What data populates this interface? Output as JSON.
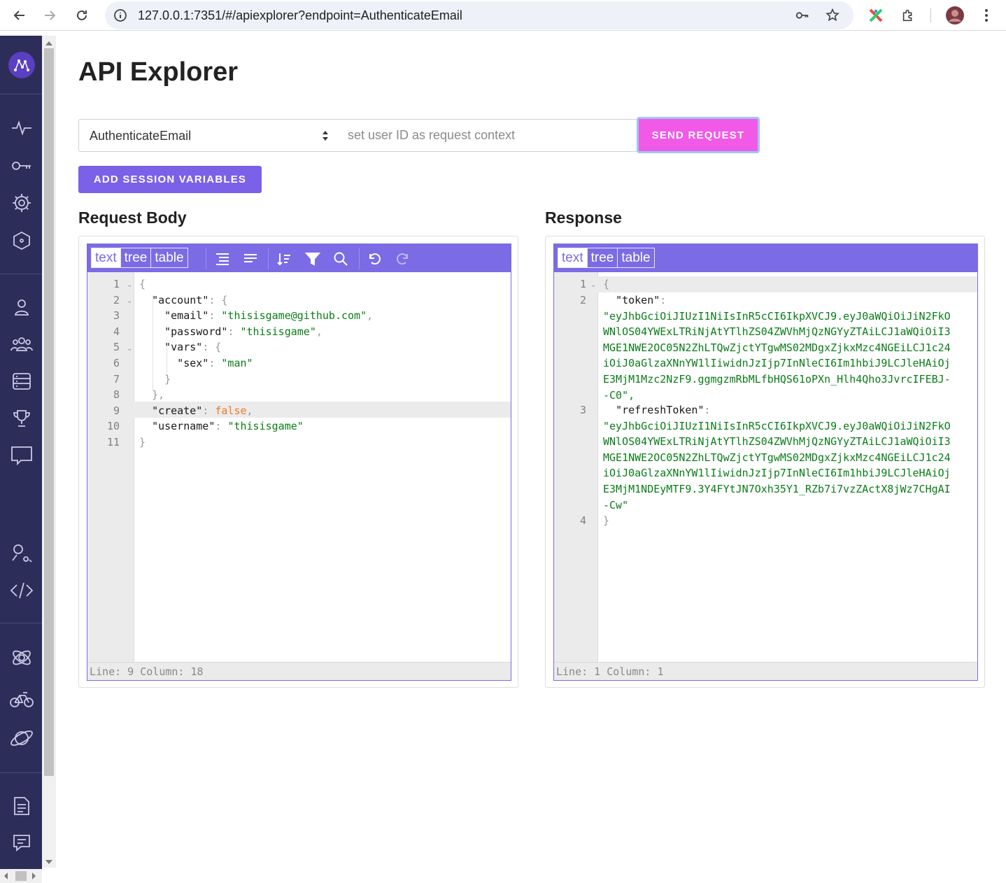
{
  "browser": {
    "url": "127.0.0.1:7351/#/apiexplorer?endpoint=AuthenticateEmail"
  },
  "page": {
    "title": "API Explorer"
  },
  "request_bar": {
    "endpoint_selected": "AuthenticateEmail",
    "user_id_placeholder": "set user ID as request context",
    "send_label": "SEND REQUEST",
    "session_vars_label": "ADD SESSION VARIABLES"
  },
  "request_panel": {
    "title": "Request Body",
    "modes": [
      "text",
      "tree",
      "table"
    ],
    "lines": [
      {
        "n": "1",
        "text": "{"
      },
      {
        "n": "2",
        "text": "  \"account\": {"
      },
      {
        "n": "3",
        "text": "    \"email\": \"thisisgame@github.com\","
      },
      {
        "n": "4",
        "text": "    \"password\": \"thisisgame\","
      },
      {
        "n": "5",
        "text": "    \"vars\": {"
      },
      {
        "n": "6",
        "text": "      \"sex\": \"man\""
      },
      {
        "n": "7",
        "text": "    }"
      },
      {
        "n": "8",
        "text": "  },"
      },
      {
        "n": "9",
        "text": "  \"create\": false,"
      },
      {
        "n": "10",
        "text": "  \"username\": \"thisisgame\""
      },
      {
        "n": "11",
        "text": "}"
      }
    ],
    "status": "Line: 9  Column: 18"
  },
  "response_panel": {
    "title": "Response",
    "modes": [
      "text",
      "tree",
      "table"
    ],
    "token_key": "\"token\"",
    "token_value_lines": [
      "\"eyJhbGciOiJIUzI1NiIsInR5cCI6IkpXVCJ9.eyJ0aWQiOiJiN2FkO",
      "WNlOS04YWExLTRiNjAtYTlhZS04ZWVhMjQzNGYyZTAiLCJ1aWQiOiI3",
      "MGE1NWE2OC05N2ZhLTQwZjctYTgwMS02MDgxZjkxMzc4NGEiLCJ1c24",
      "iOiJ0aGlzaXNnYW1lIiwidnJzIjp7InNleCI6Im1hbiJ9LCJleHAiOj",
      "E3MjM1Mzc2NzF9.ggmgzmRbMLfbHQS61oPXn_Hlh4Qho3JvrcIFEBJ-",
      "-C0\","
    ],
    "refresh_key": "\"refreshToken\"",
    "refresh_value_lines": [
      "\"eyJhbGciOiJIUzI1NiIsInR5cCI6IkpXVCJ9.eyJ0aWQiOiJiN2FkO",
      "WNlOS04YWExLTRiNjAtYTlhZS04ZWVhMjQzNGYyZTAiLCJ1aWQiOiI3",
      "MGE1NWE2OC05N2ZhLTQwZjctYTgwMS02MDgxZjkxMzc4NGEiLCJ1c24",
      "iOiJ0aGlzaXNnYW1lIiwidnJzIjp7InNleCI6Im1hbiJ9LCJleHAiOj",
      "E3MjM1NDEyMTF9.3Y4FYtJN7Oxh35Y1_RZb7i7vzZActX8jWz7CHgAI",
      "-Cw\""
    ],
    "status": "Line: 1  Column: 1"
  },
  "colors": {
    "sidebar": "#2d2d5a",
    "accent": "#7b6be4",
    "send_button": "#f15ae6"
  },
  "icons": {
    "sidebar_top": [
      "pulse-icon",
      "key-icon",
      "gear-icon",
      "hexagon-icon"
    ],
    "sidebar_middle": [
      "user-icon",
      "group-icon",
      "storage-icon",
      "trophy-icon",
      "chat-icon"
    ],
    "sidebar_tools": [
      "user-search-icon",
      "code-icon"
    ],
    "sidebar_apps": [
      "satellite-icon",
      "bike-icon",
      "planet-icon"
    ],
    "sidebar_bottom": [
      "docs-icon",
      "feedback-icon"
    ]
  }
}
